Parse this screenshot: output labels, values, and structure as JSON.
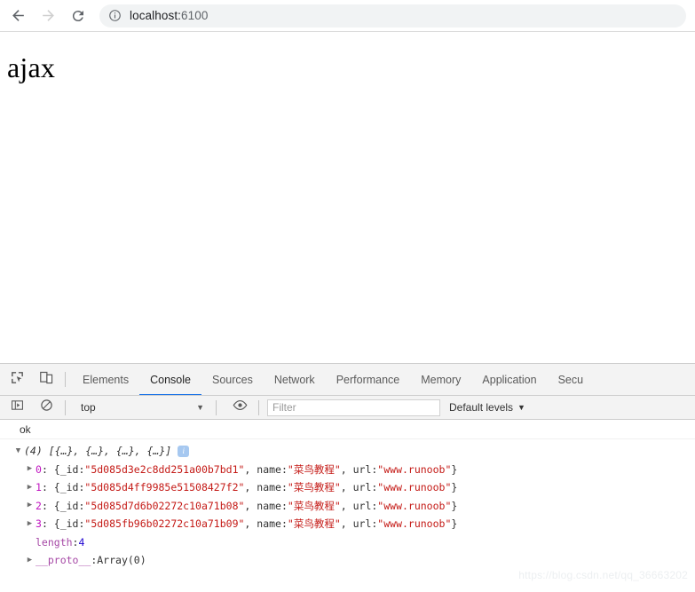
{
  "browser": {
    "back_icon": "back-arrow-icon",
    "forward_icon": "forward-arrow-icon",
    "reload_icon": "reload-icon",
    "site_info_icon": "info-circle-icon",
    "url_host": "localhost:",
    "url_port": "6100",
    "url_full": "localhost:6100"
  },
  "page": {
    "heading": "ajax"
  },
  "devtools": {
    "inspect_icon": "inspect-element-icon",
    "device_icon": "device-toolbar-icon",
    "tabs": [
      {
        "label": "Elements",
        "active": false
      },
      {
        "label": "Console",
        "active": true
      },
      {
        "label": "Sources",
        "active": false
      },
      {
        "label": "Network",
        "active": false
      },
      {
        "label": "Performance",
        "active": false
      },
      {
        "label": "Memory",
        "active": false
      },
      {
        "label": "Application",
        "active": false
      },
      {
        "label": "Secu",
        "active": false
      }
    ],
    "toolbar": {
      "sidebar_icon": "console-sidebar-icon",
      "clear_icon": "clear-console-icon",
      "context_value": "top",
      "context_caret": "▼",
      "eye_icon": "live-expression-eye-icon",
      "filter_placeholder": "Filter",
      "filter_value": "",
      "levels_label": "Default levels",
      "levels_caret": "▼"
    },
    "console": {
      "log_message": "ok",
      "array_expander": "▼",
      "array_count": "(4)",
      "array_preview": "[{…}, {…}, {…}, {…}]",
      "info_badge": "i",
      "rows": [
        {
          "expander": "▶",
          "index": "0",
          "open": ": {_id: ",
          "id": "\"5d085d3e2c8dd251a00b7bd1\"",
          "name_key": ", name: ",
          "name": "\"菜鸟教程\"",
          "url_key": ", url: ",
          "url": "\"www.runoob\"",
          "close": "}"
        },
        {
          "expander": "▶",
          "index": "1",
          "open": ": {_id: ",
          "id": "\"5d085d4ff9985e51508427f2\"",
          "name_key": ", name: ",
          "name": "\"菜鸟教程\"",
          "url_key": ", url: ",
          "url": "\"www.runoob\"",
          "close": "}"
        },
        {
          "expander": "▶",
          "index": "2",
          "open": ": {_id: ",
          "id": "\"5d085d7d6b02272c10a71b08\"",
          "name_key": ", name: ",
          "name": "\"菜鸟教程\"",
          "url_key": ", url: ",
          "url": "\"www.runoob\"",
          "close": "}"
        },
        {
          "expander": "▶",
          "index": "3",
          "open": ": {_id: ",
          "id": "\"5d085fb96b02272c10a71b09\"",
          "name_key": ", name: ",
          "name": "\"菜鸟教程\"",
          "url_key": ", url: ",
          "url": "\"www.runoob\"",
          "close": "}"
        }
      ],
      "length_key": "length",
      "length_sep": ": ",
      "length_value": "4",
      "proto_expander": "▶",
      "proto_key": "__proto__",
      "proto_sep": ": ",
      "proto_value": "Array(0)"
    }
  },
  "watermark": "https://blog.csdn.net/qq_36663202"
}
